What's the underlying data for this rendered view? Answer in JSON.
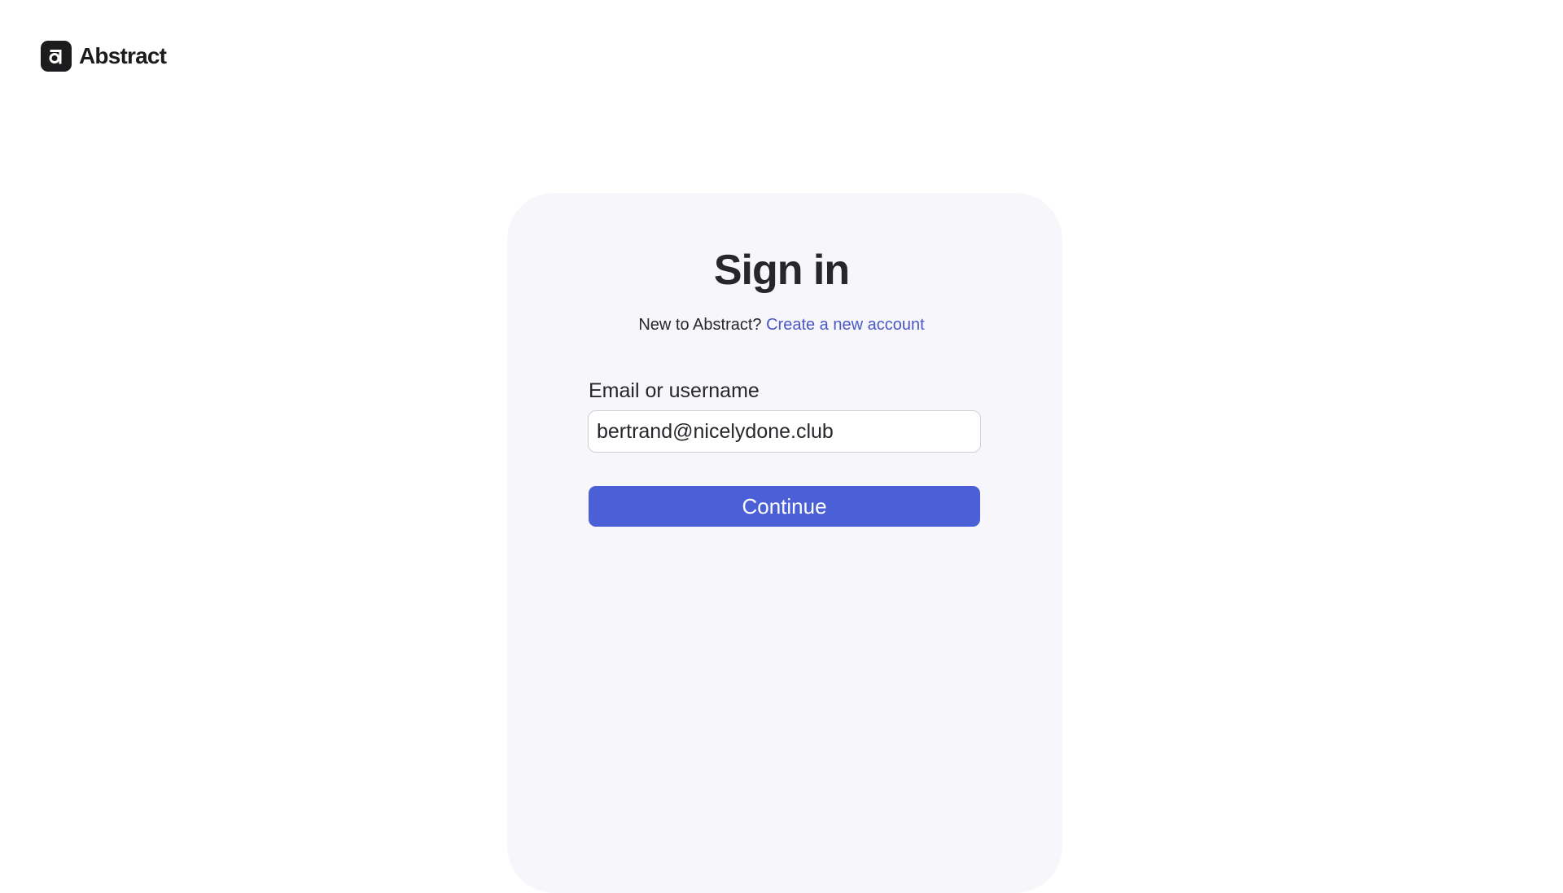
{
  "brand": {
    "name": "Abstract",
    "logo_icon": "abstract-logo-icon",
    "logo_color": "#1c1c1e"
  },
  "signin": {
    "title": "Sign in",
    "prompt": "New to Abstract?",
    "create_account_link": "Create a new account",
    "link_color": "#4a58c4"
  },
  "form": {
    "email_label": "Email or username",
    "email_value": "bertrand@nicelydone.club",
    "continue_label": "Continue",
    "button_color": "#4b5fd6"
  },
  "colors": {
    "card_background": "#f6f6fb",
    "page_background": "#ffffff",
    "text": "#26272b"
  }
}
